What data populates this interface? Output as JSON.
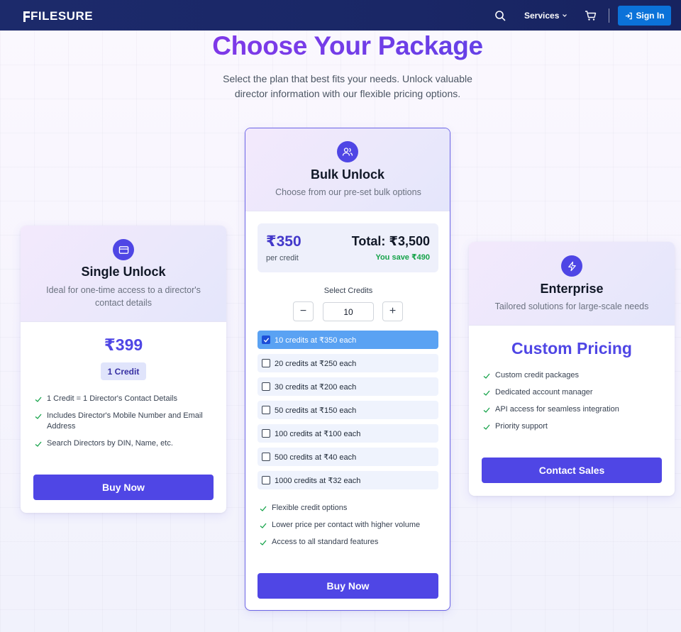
{
  "nav": {
    "logo": "FILESURE",
    "services_label": "Services",
    "signin_label": "Sign In"
  },
  "hero": {
    "title": "Choose Your Package",
    "subtitle": "Select the plan that best fits your needs. Unlock valuable director information with our flexible pricing options."
  },
  "single": {
    "title": "Single Unlock",
    "description": "Ideal for one-time access to a director's contact details",
    "price": "₹399",
    "badge": "1 Credit",
    "features": [
      "1 Credit = 1 Director's Contact Details",
      "Includes Director's Mobile Number and Email Address",
      "Search Directors by DIN, Name, etc."
    ],
    "button": "Buy Now"
  },
  "bulk": {
    "title": "Bulk Unlock",
    "description": "Choose from our pre-set bulk options",
    "price": "₹350",
    "per_credit": "per credit",
    "total": "Total: ₹3,500",
    "savings": "You save ₹490",
    "select_label": "Select Credits",
    "decrement": "−",
    "increment": "+",
    "quantity": "10",
    "options": [
      {
        "label": "10 credits at ₹350 each",
        "selected": true
      },
      {
        "label": "20 credits at ₹250 each",
        "selected": false
      },
      {
        "label": "30 credits at ₹200 each",
        "selected": false
      },
      {
        "label": "50 credits at ₹150 each",
        "selected": false
      },
      {
        "label": "100 credits at ₹100 each",
        "selected": false
      },
      {
        "label": "500 credits at ₹40 each",
        "selected": false
      },
      {
        "label": "1000 credits at ₹32 each",
        "selected": false
      }
    ],
    "features": [
      "Flexible credit options",
      "Lower price per contact with higher volume",
      "Access to all standard features"
    ],
    "button": "Buy Now"
  },
  "enterprise": {
    "title": "Enterprise",
    "description": "Tailored solutions for large-scale needs",
    "price": "Custom Pricing",
    "features": [
      "Custom credit packages",
      "Dedicated account manager",
      "API access for seamless integration",
      "Priority support"
    ],
    "button": "Contact Sales"
  },
  "colors": {
    "nav_bg": "#1c2a6b",
    "accent": "#4f46e5",
    "signin_bg": "#0b72d9",
    "check_green": "#16a34a",
    "selected_option": "#5aa2f3"
  }
}
